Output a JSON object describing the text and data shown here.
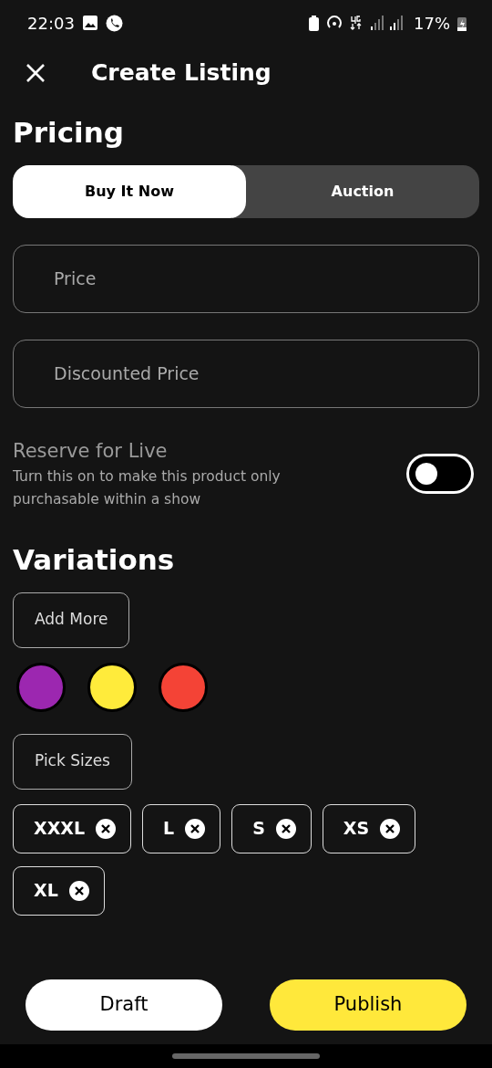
{
  "status_bar": {
    "time": "22:03",
    "battery": "17%"
  },
  "header": {
    "title": "Create Listing"
  },
  "pricing": {
    "heading": "Pricing",
    "tabs": [
      {
        "label": "Buy It Now",
        "selected": true
      },
      {
        "label": "Auction",
        "selected": false
      }
    ],
    "fields": [
      {
        "placeholder": "Price"
      },
      {
        "placeholder": "Discounted Price"
      }
    ],
    "reserve": {
      "title": "Reserve for Live",
      "description": "Turn this on to make this product only purchasable within a show",
      "on": false
    }
  },
  "variations": {
    "heading": "Variations",
    "add_button": "Add More",
    "colors": [
      {
        "color": "#9c27b0"
      },
      {
        "color": "#ffeb3b"
      },
      {
        "color": "#f44336"
      }
    ],
    "sizes_button": "Pick Sizes",
    "sizes": [
      {
        "label": "XXXL"
      },
      {
        "label": "L"
      },
      {
        "label": "S"
      },
      {
        "label": "XS"
      },
      {
        "label": "XL"
      }
    ]
  },
  "actions": {
    "draft": "Draft",
    "publish": "Publish"
  }
}
